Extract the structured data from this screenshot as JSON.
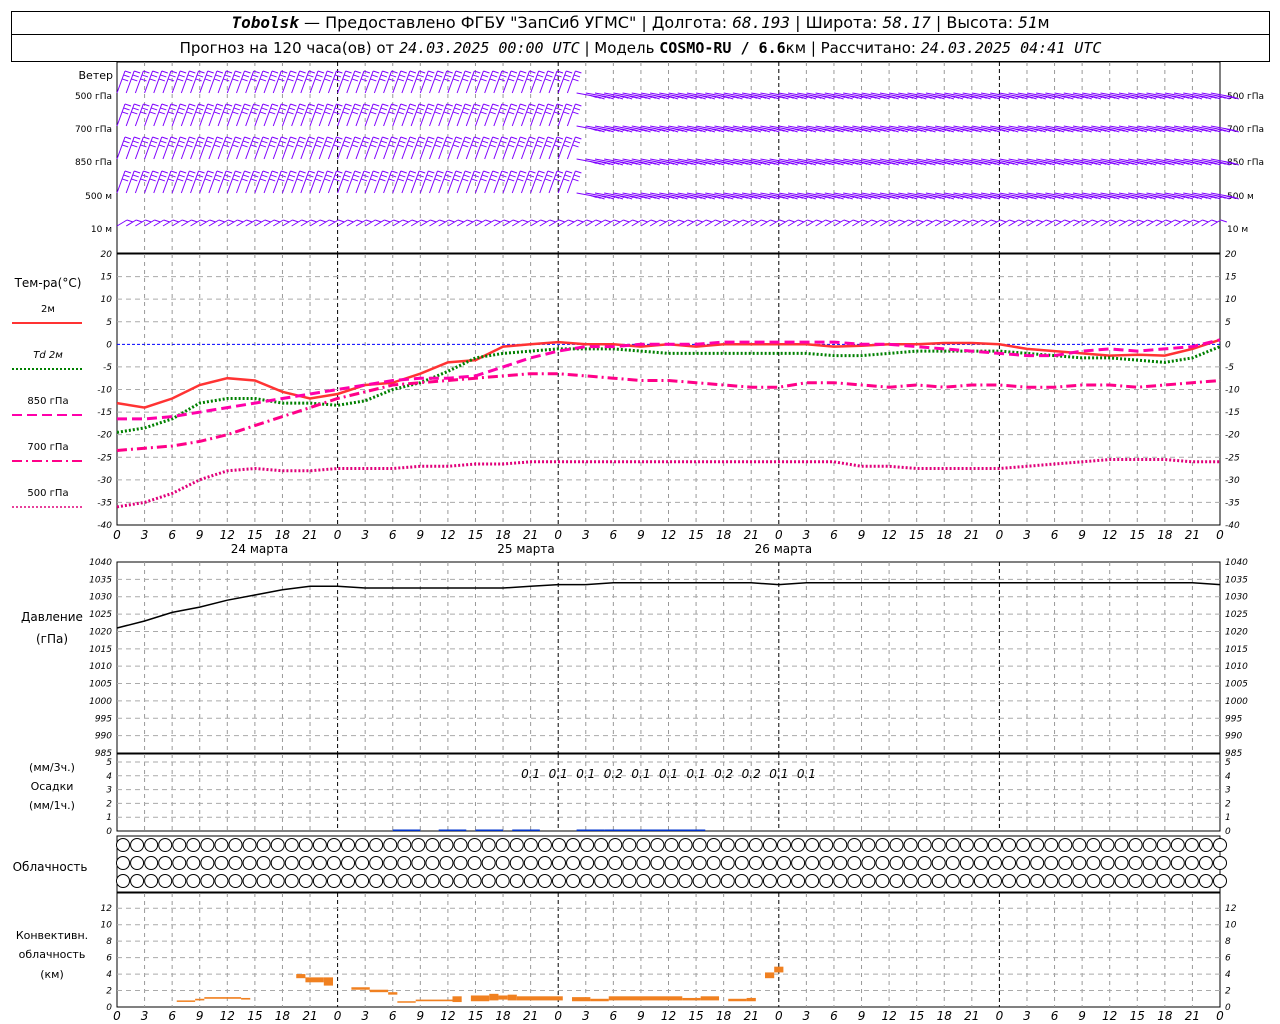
{
  "header": {
    "station": "Tobolsk",
    "provider": "— Предоставлено ФГБУ \"ЗапСиб УГМС\"",
    "lon_label": "Долгота:",
    "lon": "68.193",
    "lat_label": "Широта:",
    "lat": "58.17",
    "elev_label": "Высота:",
    "elev": "51",
    "elev_unit": "м",
    "forecast_label": "Прогноз на 120 часа(ов) от",
    "forecast_start": "24.03.2025 00:00 UTC",
    "model_label": "Модель",
    "model": "COSMO-RU / 6.6",
    "model_unit": "км",
    "computed_label": "Рассчитано:",
    "computed": "24.03.2025 04:41 UTC"
  },
  "colors": {
    "wind": "#7f00ff",
    "t2m": "#ff3333",
    "td2m": "#008000",
    "t850": "#ff00aa",
    "t700": "#ff0088",
    "t500": "#e0007a",
    "zero_line": "#0000ff",
    "pressure": "#000000",
    "precip": "#0033cc",
    "convective": "#f08020"
  },
  "chart_data": [
    {
      "type": "wind_barbs",
      "title": "Ветер",
      "levels": [
        "500 гПа",
        "700 гПа",
        "850 гПа",
        "500 м",
        "10  м"
      ]
    },
    {
      "type": "line",
      "title": "Тем-ра(°C)",
      "x_hours": [
        0,
        3,
        6,
        9,
        12,
        15,
        18,
        21,
        24,
        27,
        30,
        33,
        36,
        39,
        42,
        45,
        48,
        51,
        54,
        57,
        60,
        63,
        66,
        69,
        72,
        75,
        78,
        81,
        84,
        87,
        90,
        93,
        96,
        99,
        102,
        105,
        108,
        111,
        114,
        117,
        120
      ],
      "x_tick_labels": [
        "0",
        "3",
        "6",
        "9",
        "12",
        "15",
        "18",
        "21",
        "0",
        "3",
        "6",
        "9",
        "12",
        "15",
        "18",
        "21",
        "0",
        "3",
        "6",
        "9",
        "12",
        "15",
        "18",
        "21",
        "0",
        "3",
        "6",
        "9",
        "12",
        "15",
        "18",
        "21",
        "0",
        "3",
        "6",
        "9",
        "12",
        "15",
        "18",
        "21",
        "0",
        "3",
        "6"
      ],
      "day_labels": [
        "24 марта",
        "25 марта",
        "26 марта"
      ],
      "ylim": [
        -40,
        20
      ],
      "y_ticks": [
        20,
        15,
        10,
        5,
        0,
        -5,
        -10,
        -15,
        -20,
        -25,
        -30,
        -35,
        -40
      ],
      "series": [
        {
          "name": "2м",
          "values": [
            -13,
            -14,
            -12,
            -9,
            -7.5,
            -8,
            -10.5,
            -12,
            -11,
            -9,
            -8.5,
            -6.5,
            -4,
            -3.5,
            -0.5,
            0,
            0.5,
            0,
            0,
            -0.5,
            0,
            -0.5,
            0,
            0,
            0,
            0,
            -0.5,
            -0.3,
            0,
            0,
            0.3,
            0.3,
            0,
            -1,
            -1.5,
            -2,
            -2.5,
            -2.3,
            -2.5,
            -1,
            1
          ]
        },
        {
          "name": "Td 2м",
          "values": [
            -19.5,
            -18.5,
            -16.5,
            -13,
            -12,
            -12,
            -13,
            -13,
            -13.5,
            -12.5,
            -10,
            -8.5,
            -6,
            -3,
            -2,
            -1.5,
            -1,
            -1,
            -1,
            -1.5,
            -2,
            -2,
            -2,
            -2,
            -2,
            -2,
            -2.5,
            -2.5,
            -2,
            -1.5,
            -1.5,
            -1.5,
            -1.5,
            -2,
            -2.5,
            -3,
            -3,
            -3.5,
            -4,
            -3,
            -0.5
          ]
        },
        {
          "name": "850 гПа",
          "values": [
            -16.5,
            -16.5,
            -16,
            -15,
            -14,
            -13,
            -12,
            -11,
            -10,
            -9,
            -8,
            -7.5,
            -7.5,
            -7,
            -5,
            -3,
            -1.5,
            -0.5,
            -0.5,
            0,
            0,
            0,
            0.5,
            0.5,
            0.5,
            0.5,
            0.5,
            0,
            0,
            -0.5,
            -1,
            -1.5,
            -2,
            -2.5,
            -2.5,
            -1.5,
            -1,
            -1.5,
            -1,
            -0.5,
            1
          ]
        },
        {
          "name": "700 гПа",
          "values": [
            -23.5,
            -23,
            -22.5,
            -21.5,
            -20,
            -18,
            -16,
            -14,
            -12,
            -10.5,
            -9,
            -8.5,
            -8,
            -7.5,
            -7,
            -6.5,
            -6.5,
            -7,
            -7.5,
            -8,
            -8,
            -8.5,
            -9,
            -9.5,
            -9.5,
            -8.5,
            -8.5,
            -9,
            -9.5,
            -9,
            -9.5,
            -9,
            -9,
            -9.5,
            -9.5,
            -9,
            -9,
            -9.5,
            -9,
            -8.5,
            -8
          ]
        },
        {
          "name": "500 гПа",
          "values": [
            -36,
            -35,
            -33,
            -30,
            -28,
            -27.5,
            -28,
            -28,
            -27.5,
            -27.5,
            -27.5,
            -27,
            -27,
            -26.5,
            -26.5,
            -26,
            -26,
            -26,
            -26,
            -26,
            -26,
            -26,
            -26,
            -26,
            -26,
            -26,
            -26,
            -27,
            -27,
            -27.5,
            -27.5,
            -27.5,
            -27.5,
            -27,
            -26.5,
            -26,
            -25.5,
            -25.5,
            -25.5,
            -26,
            -26
          ]
        }
      ]
    },
    {
      "type": "line",
      "title": "Давление",
      "unit": "(гПа)",
      "ylim": [
        985,
        1040
      ],
      "y_ticks": [
        1040,
        1035,
        1030,
        1025,
        1020,
        1015,
        1010,
        1005,
        1000,
        995,
        990,
        985
      ],
      "x_hours": [
        0,
        3,
        6,
        9,
        12,
        15,
        18,
        21,
        24,
        27,
        30,
        33,
        36,
        39,
        42,
        45,
        48,
        51,
        54,
        57,
        60,
        63,
        66,
        69,
        72,
        75,
        78,
        81,
        84,
        87,
        90,
        93,
        96,
        99,
        102,
        105,
        108,
        111,
        114,
        117,
        120
      ],
      "series": [
        {
          "name": "Давление",
          "values": [
            1021,
            1023,
            1025.5,
            1027,
            1029,
            1030.5,
            1032,
            1033,
            1033,
            1032.5,
            1032.5,
            1032.5,
            1032.5,
            1032.5,
            1032.5,
            1033,
            1033.5,
            1033.5,
            1034,
            1034,
            1034,
            1034,
            1034,
            1034,
            1033.5,
            1034,
            1034,
            1034,
            1034,
            1034,
            1034,
            1034,
            1034,
            1034,
            1034,
            1034,
            1034,
            1034,
            1034,
            1034,
            1033.5
          ]
        }
      ]
    },
    {
      "type": "bar",
      "title": "Осадки",
      "unit_top": "(мм/3ч.)",
      "unit_bottom": "(мм/1ч.)",
      "ylim": [
        0,
        5
      ],
      "y_ticks": [
        5,
        4,
        3,
        2,
        1,
        0
      ],
      "data_labels": [
        {
          "hour": 45,
          "text": "0.1"
        },
        {
          "hour": 48,
          "text": "0.1"
        },
        {
          "hour": 51,
          "text": "0.1"
        },
        {
          "hour": 54,
          "text": "0.2"
        },
        {
          "hour": 57,
          "text": "0.1"
        },
        {
          "hour": 60,
          "text": "0.1"
        },
        {
          "hour": 63,
          "text": "0.1"
        },
        {
          "hour": 66,
          "text": "0.2"
        },
        {
          "hour": 69,
          "text": "0.2"
        },
        {
          "hour": 72,
          "text": "0.1"
        },
        {
          "hour": 75,
          "text": "0.1"
        }
      ],
      "bars_hourly": [
        {
          "from": 30,
          "to": 33,
          "value": 0.1
        },
        {
          "from": 35,
          "to": 38,
          "value": 0.1
        },
        {
          "from": 39,
          "to": 42,
          "value": 0.1
        },
        {
          "from": 43,
          "to": 46,
          "value": 0.1
        },
        {
          "from": 50,
          "to": 53,
          "value": 0.1
        },
        {
          "from": 53,
          "to": 60,
          "value": 0.1
        },
        {
          "from": 60,
          "to": 64,
          "value": 0.05
        }
      ]
    },
    {
      "type": "cloud_cover",
      "title": "Облачность",
      "levels": [
        "high",
        "middle",
        "low"
      ],
      "hours_count": 79,
      "rows_eighths": {
        "high": "0000000000000000000000000000000000000000000000000000000000000000000000000000000",
        "middle": "0000000000000000000000000000000000000000000000000000000000000000000000000000000",
        "low": "0000000000000000000000000000000000000000000000000000000000000000000000000000000"
      }
    },
    {
      "type": "bar",
      "title": "Конвективн. облачность",
      "unit": "(км)",
      "ylim": [
        0,
        13
      ],
      "y_ticks": [
        12,
        10,
        8,
        6,
        4,
        2,
        0
      ],
      "segments": [
        {
          "from": 6.5,
          "to": 8.5,
          "base": 0.7,
          "top": 0.8
        },
        {
          "from": 8.5,
          "to": 9.5,
          "base": 0.8,
          "top": 1.0
        },
        {
          "from": 9.5,
          "to": 13.5,
          "base": 1.0,
          "top": 1.2
        },
        {
          "from": 13.5,
          "to": 14.5,
          "base": 0.9,
          "top": 1.1
        },
        {
          "from": 19.5,
          "to": 20.5,
          "base": 3.5,
          "top": 4.0
        },
        {
          "from": 20.5,
          "to": 22.5,
          "base": 3.0,
          "top": 3.6
        },
        {
          "from": 22.5,
          "to": 23.5,
          "base": 2.6,
          "top": 3.6
        },
        {
          "from": 25.5,
          "to": 27.5,
          "base": 2.1,
          "top": 2.4
        },
        {
          "from": 27.5,
          "to": 29.5,
          "base": 1.8,
          "top": 2.1
        },
        {
          "from": 29.5,
          "to": 30.5,
          "base": 1.5,
          "top": 1.8
        },
        {
          "from": 30.5,
          "to": 32.5,
          "base": 0.6,
          "top": 0.7
        },
        {
          "from": 32.5,
          "to": 36.5,
          "base": 0.7,
          "top": 0.9
        },
        {
          "from": 36.5,
          "to": 37.5,
          "base": 0.6,
          "top": 1.3
        },
        {
          "from": 38.5,
          "to": 40.5,
          "base": 0.7,
          "top": 1.4
        },
        {
          "from": 40.5,
          "to": 41.5,
          "base": 0.8,
          "top": 1.6
        },
        {
          "from": 41.5,
          "to": 42.5,
          "base": 0.9,
          "top": 1.4
        },
        {
          "from": 42.5,
          "to": 43.5,
          "base": 0.8,
          "top": 1.5
        },
        {
          "from": 43.5,
          "to": 48.5,
          "base": 0.8,
          "top": 1.3
        },
        {
          "from": 49.5,
          "to": 51.5,
          "base": 0.7,
          "top": 1.2
        },
        {
          "from": 51.5,
          "to": 53.5,
          "base": 0.7,
          "top": 1.0
        },
        {
          "from": 53.5,
          "to": 61.5,
          "base": 0.8,
          "top": 1.3
        },
        {
          "from": 61.5,
          "to": 63.5,
          "base": 0.8,
          "top": 1.1
        },
        {
          "from": 63.5,
          "to": 65.5,
          "base": 0.8,
          "top": 1.3
        },
        {
          "from": 66.5,
          "to": 68.5,
          "base": 0.7,
          "top": 1.0
        },
        {
          "from": 68.5,
          "to": 69.5,
          "base": 0.7,
          "top": 1.1
        },
        {
          "from": 70.5,
          "to": 71.5,
          "base": 3.5,
          "top": 4.2
        },
        {
          "from": 71.5,
          "to": 72.5,
          "base": 4.2,
          "top": 4.9
        }
      ]
    }
  ]
}
